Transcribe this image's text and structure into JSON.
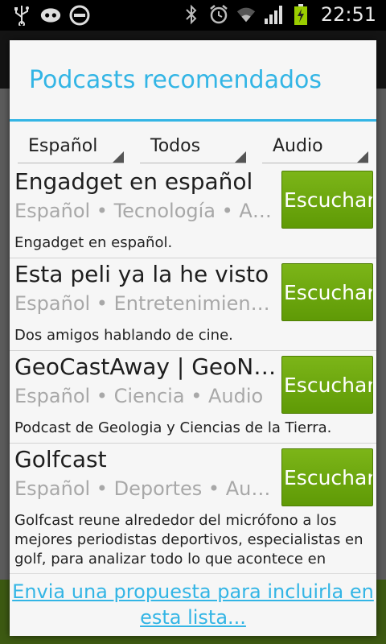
{
  "status_bar": {
    "time": "22:51",
    "left_icons": [
      "usb-icon",
      "voicemail-icon",
      "do-not-disturb-icon"
    ],
    "right_icons": [
      "bluetooth-icon",
      "alarm-icon",
      "wifi-icon",
      "signal-icon",
      "battery-charging-icon"
    ]
  },
  "dialog": {
    "title": "Podcasts recomendados",
    "filters": {
      "language": "Español",
      "category": "Todos",
      "format": "Audio"
    },
    "listen_label": "Escuchar",
    "items": [
      {
        "title": "Engadget en español",
        "meta": "Español • Tecnología • Audio",
        "description": "Engadget en español."
      },
      {
        "title": "Esta peli ya la he visto",
        "meta": "Español • Entretenimiento • Audio",
        "description": "Dos amigos hablando de cine."
      },
      {
        "title": "GeoCastAway | GeoNáutica",
        "meta": "Español • Ciencia • Audio",
        "description": "Podcast de Geologia y Ciencias de la Tierra."
      },
      {
        "title": "Golfcast",
        "meta": "Español • Deportes • Audio",
        "description": "Golfcast reune alrededor del micrófono a los mejores periodistas deportivos, especialistas en golf, para analizar todo lo que acontece en"
      }
    ],
    "submit_link": "Envia una propuesta para incluirla en esta lista..."
  },
  "colors": {
    "accent": "#33b5e5",
    "button_green": "#6aa80c",
    "background": "#f6f6f6"
  }
}
